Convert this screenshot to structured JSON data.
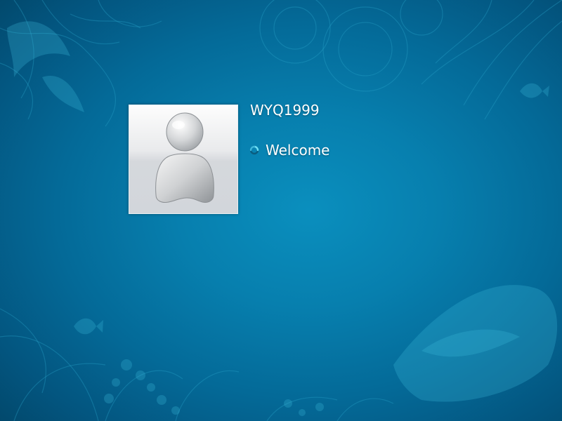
{
  "logon": {
    "username": "WYQ1999",
    "status_text": "Welcome"
  },
  "icons": {
    "avatar": "user-silhouette-icon",
    "spinner": "loading-spinner-icon"
  },
  "colors": {
    "background_center": "#0a8fbe",
    "background_edge": "#024668",
    "text": "#ffffff",
    "spinner": "#4fd0ec"
  }
}
